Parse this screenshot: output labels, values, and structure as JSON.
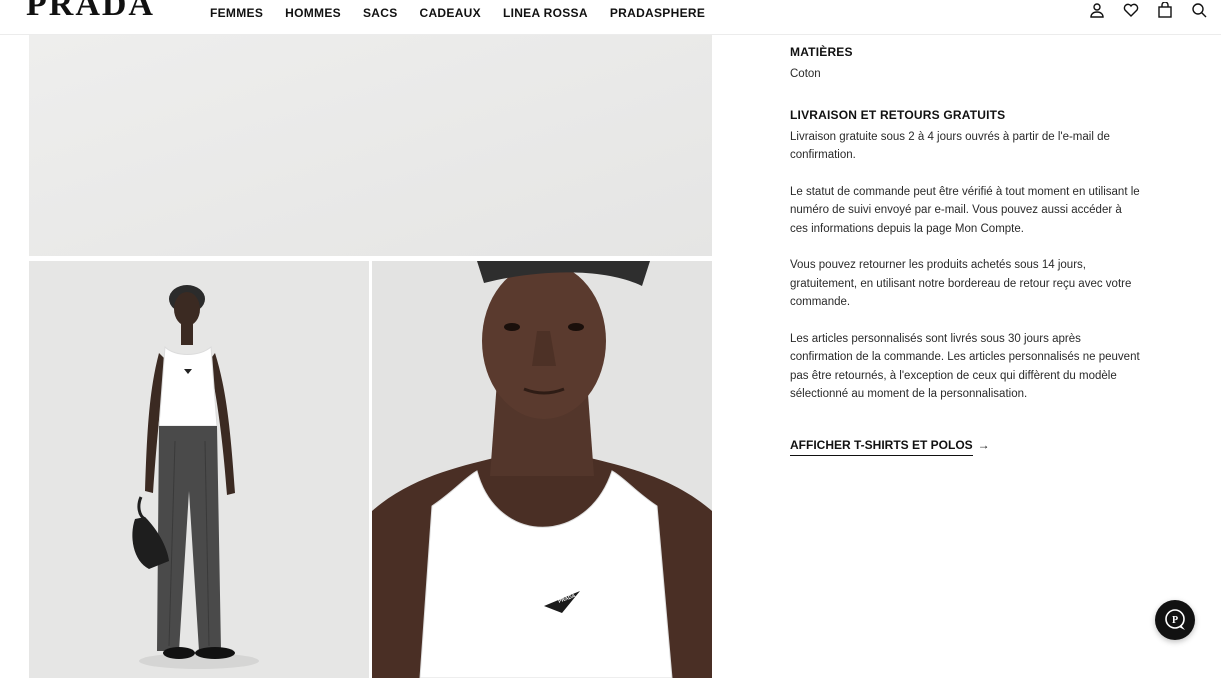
{
  "brand": {
    "logo": "PRADA"
  },
  "nav": {
    "items": [
      "FEMMES",
      "HOMMES",
      "SACS",
      "CADEAUX",
      "LINEA ROSSA",
      "PRADASPHERE"
    ]
  },
  "header_icons": [
    "user-icon",
    "heart-icon",
    "bag-icon",
    "search-icon"
  ],
  "product": {
    "images": [
      {
        "name": "product-image-top",
        "alt": ""
      },
      {
        "name": "product-image-full-body",
        "alt": ""
      },
      {
        "name": "product-image-closeup",
        "alt": ""
      }
    ],
    "tank_logo_text": "PRADA"
  },
  "details": {
    "materials": {
      "heading": "MATIÈRES",
      "value": "Coton"
    },
    "shipping": {
      "heading": "LIVRAISON ET RETOURS GRATUITS",
      "paragraphs": [
        "Livraison gratuite sous 2 à 4 jours ouvrés à partir de l'e-mail de confirmation.",
        "Le statut de commande peut être vérifié à tout moment en utilisant le numéro de suivi envoyé par e-mail. Vous pouvez aussi accéder à ces informations depuis la page Mon Compte.",
        "Vous pouvez retourner les produits achetés sous 14 jours, gratuitement, en utilisant notre bordereau de retour reçu avec votre commande.",
        "Les articles personnalisés sont livrés sous 30 jours après confirmation de la commande. Les articles personnalisés ne peuvent pas être retournés, à l'exception de ceux qui diffèrent du modèle sélectionné au moment de la personnalisation."
      ]
    },
    "cta": {
      "label": "AFFICHER T-SHIRTS ET POLOS",
      "arrow": "→"
    }
  },
  "chat": {
    "icon": "chat-icon"
  },
  "colors": {
    "text": "#1a1a1a",
    "chat_bg": "#111111",
    "image_bg": "#ebebea"
  }
}
